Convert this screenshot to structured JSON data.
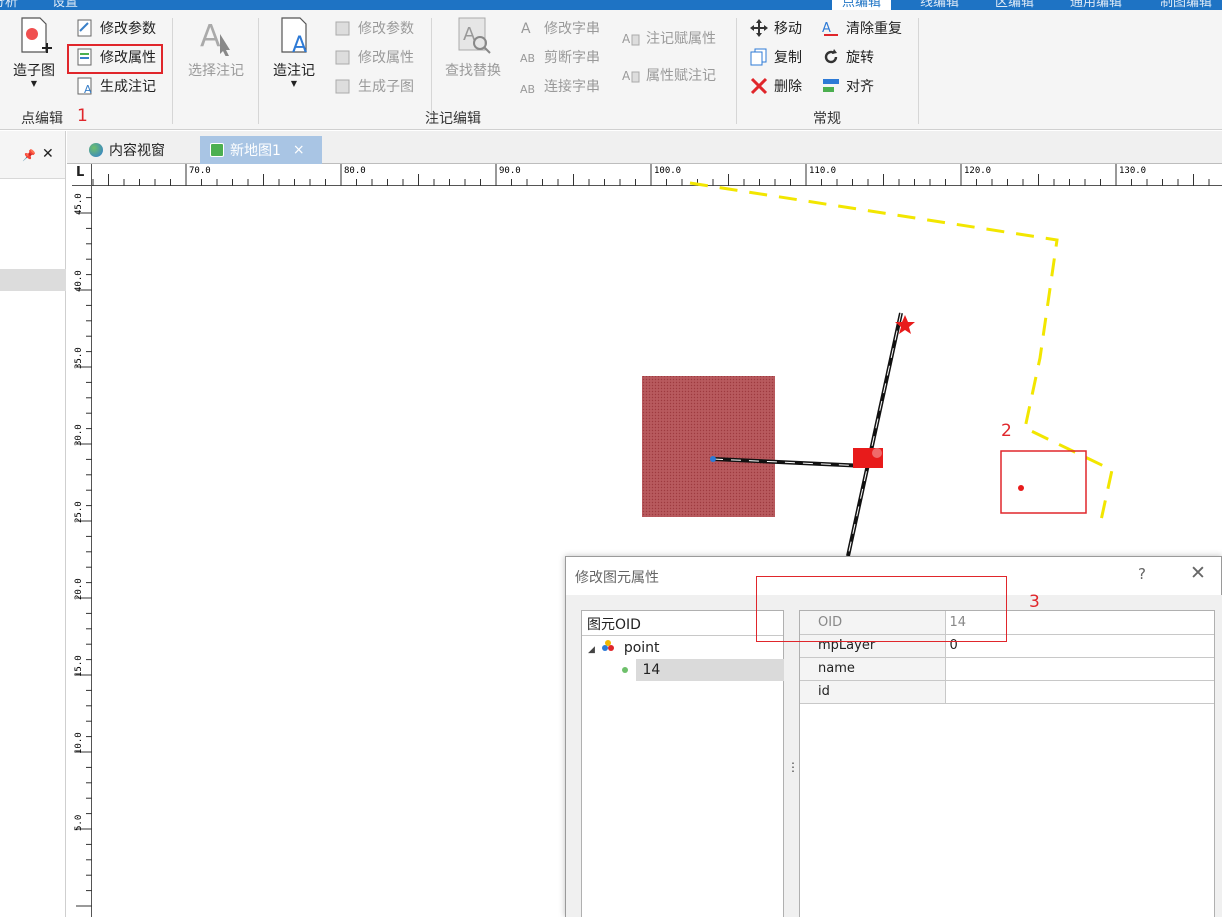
{
  "top_tabs": [
    {
      "label": "分析",
      "active": false
    },
    {
      "label": "设置",
      "active": false
    },
    {
      "label": "点编辑",
      "active": true
    },
    {
      "label": "线编辑",
      "active": false
    },
    {
      "label": "区编辑",
      "active": false
    },
    {
      "label": "通用编辑",
      "active": false
    },
    {
      "label": "制图编辑",
      "active": false
    }
  ],
  "ribbon": {
    "point_edit": {
      "group_label": "点编辑",
      "make_subgraph": "造子图",
      "modify_params": "修改参数",
      "modify_attributes": "修改属性",
      "generate_annotation": "生成注记"
    },
    "annotation_edit": {
      "group_label": "注记编辑",
      "select_annotation": "选择注记",
      "make_annotation": "造注记",
      "modify_params": "修改参数",
      "modify_attributes": "修改属性",
      "generate_subgraph": "生成子图",
      "find_replace": "查找替换",
      "modify_string": "修改字串",
      "cut_string": "剪断字串",
      "connect_string": "连接字串",
      "annotation_assign_attr": "注记赋属性",
      "attr_assign_annotation": "属性赋注记"
    },
    "general": {
      "group_label": "常规",
      "move": "移动",
      "copy": "复制",
      "delete": "删除",
      "clear_duplicates": "清除重复",
      "rotate": "旋转",
      "align": "对齐"
    }
  },
  "step_labels": [
    "1",
    "2",
    "3"
  ],
  "doc_tabs": [
    {
      "label": "内容视窗",
      "active": false
    },
    {
      "label": "新地图1",
      "active": true,
      "close": "×"
    }
  ],
  "left_panel": {
    "pin": "📌",
    "close": "✕"
  },
  "ruler": {
    "top_labels": [
      "70.0",
      "80.0",
      "90.0",
      "100.0",
      "110.0",
      "120.0",
      "130.0"
    ],
    "left_labels": [
      "45.0",
      "40.0",
      "35.0",
      "30.0",
      "25.0",
      "20.0",
      "15.0",
      "10.0",
      "5.0"
    ],
    "corner": "L"
  },
  "dialog": {
    "title": "修改图元属性",
    "help": "?",
    "close": "✕",
    "tree_header": "图元OID",
    "tree_root": "point",
    "tree_child": "14",
    "fields": [
      {
        "key": "OID",
        "value": "14",
        "readonly": true
      },
      {
        "key": "mpLayer",
        "value": "0",
        "readonly": false
      },
      {
        "key": "name",
        "value": "",
        "readonly": false
      },
      {
        "key": "id",
        "value": "",
        "readonly": false
      }
    ]
  },
  "colors": {
    "accent": "#1e73c4",
    "highlight_red": "#e0262b",
    "boundary_yellow": "#f2e600",
    "polygon_fill": "#b85a5e"
  }
}
